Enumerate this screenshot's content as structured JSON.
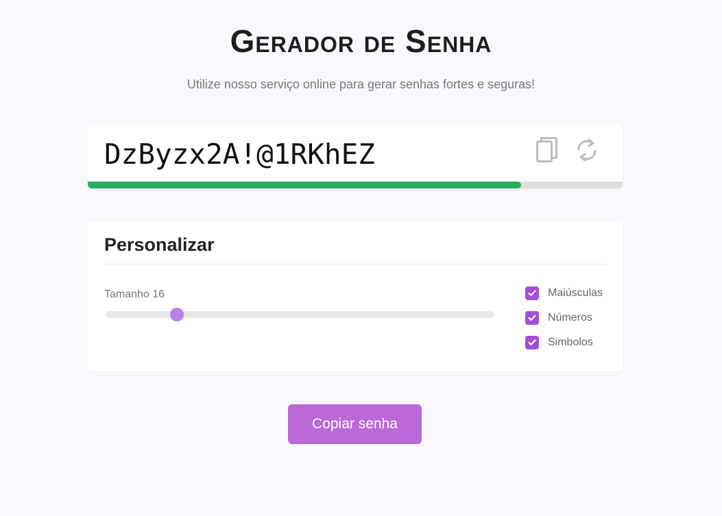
{
  "header": {
    "title": "Gerador de Senha",
    "subtitle": "Utilize nosso serviço online para gerar senhas fortes e seguras!"
  },
  "password": {
    "value": "DzByzx2A!@1RKhEZ",
    "copy_icon": "copy-icon",
    "refresh_icon": "refresh-icon",
    "strength_fraction": 0.81,
    "strength_color": "#27ae60"
  },
  "customize": {
    "title": "Personalizar",
    "size_label": "Tamanho 16",
    "slider_fraction": 0.184,
    "options": [
      {
        "label": "Maiúsculas",
        "checked": true
      },
      {
        "label": "Números",
        "checked": true
      },
      {
        "label": "Simbolos",
        "checked": true
      }
    ]
  },
  "actions": {
    "copy_button": "Copiar senha"
  },
  "colors": {
    "accent": "#bb68d8",
    "checkbox": "#9f4fd8",
    "slider_thumb": "#b87fe6",
    "background": "#f8f9fd"
  }
}
